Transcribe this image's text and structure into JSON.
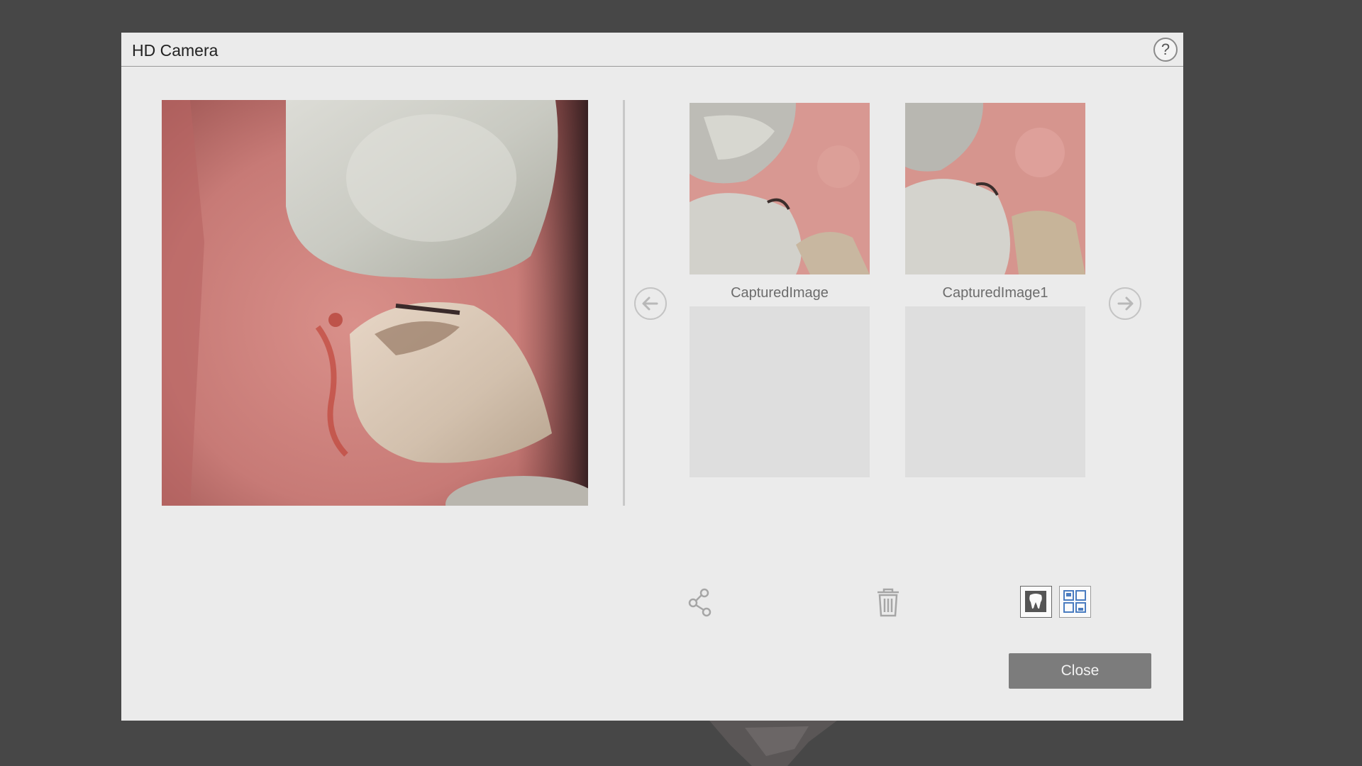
{
  "dialog": {
    "title": "HD Camera",
    "help_label": "?"
  },
  "preview": {
    "icon": "intraoral-live-image"
  },
  "navigation": {
    "prev_icon": "arrow-left-icon",
    "next_icon": "arrow-right-icon"
  },
  "gallery": {
    "items": [
      {
        "label": "CapturedImage"
      },
      {
        "label": "CapturedImage1"
      }
    ]
  },
  "toolbar": {
    "share_icon": "share-icon",
    "delete_icon": "trash-icon",
    "view_tooth_icon": "tooth-icon",
    "view_grid_icon": "grid-icon"
  },
  "footer": {
    "close_label": "Close"
  },
  "colors": {
    "dialog_bg": "#ebebeb",
    "backdrop": "#474747",
    "close_button": "#7c7c7c",
    "accent_blue": "#4a7cc0"
  }
}
